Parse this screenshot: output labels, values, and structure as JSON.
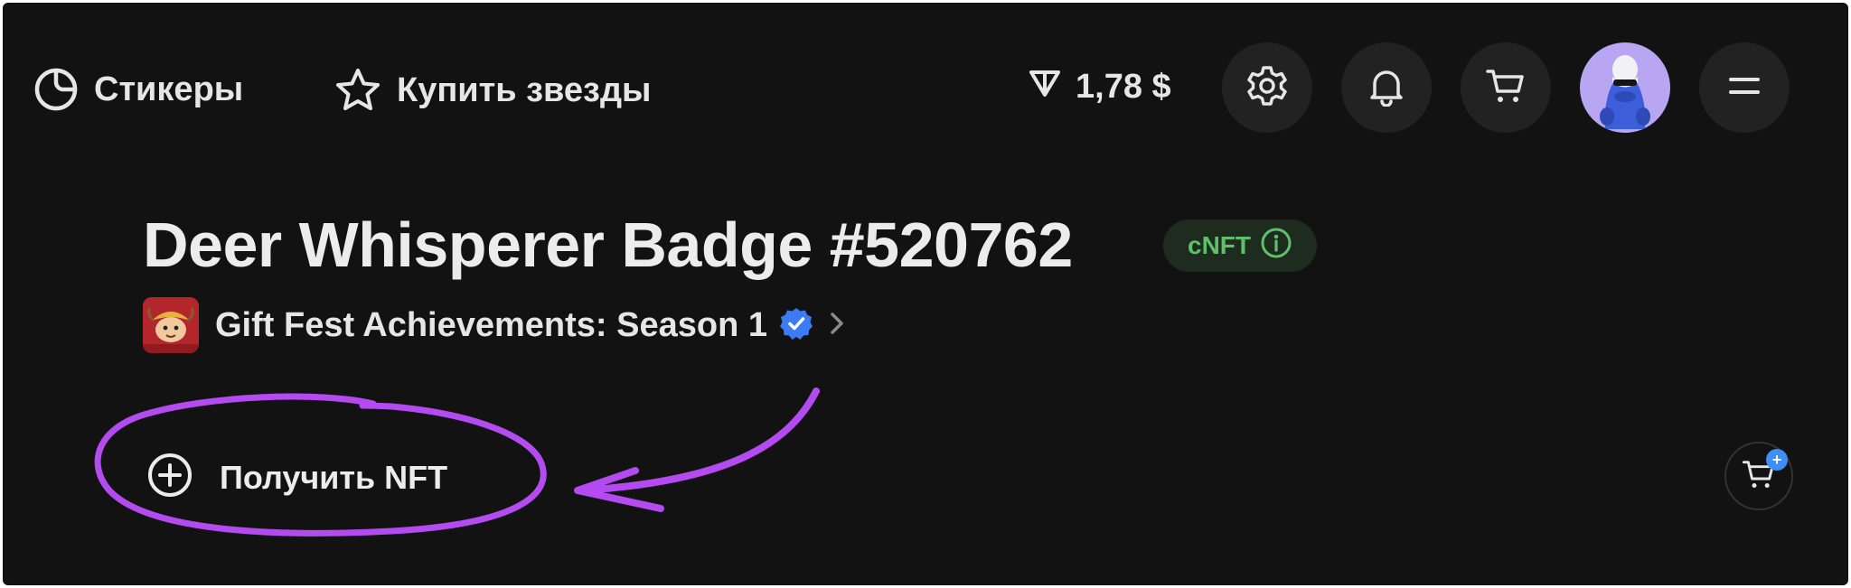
{
  "nav": {
    "stickers_label": "Стикеры",
    "buy_stars_label": "Купить звезды",
    "balance": "1,78 $",
    "icons": {
      "stickers": "sticker-icon",
      "buy_stars": "star-icon",
      "currency": "ton-icon",
      "settings": "gear-icon",
      "notifications": "bell-icon",
      "cart": "cart-icon",
      "menu": "hamburger-icon"
    }
  },
  "nft": {
    "title": "Deer Whisperer Badge #520762",
    "type_badge": "cNFT",
    "collection": "Gift Fest Achievements: Season 1",
    "collection_verified": true
  },
  "actions": {
    "get_nft_label": "Получить NFT",
    "cart_badge": "+"
  },
  "colors": {
    "background": "#121212",
    "badge_green": "#5fbf6a",
    "annotation_purple": "#b44bf0",
    "verified_blue": "#3d7bf5",
    "avatar_bg": "#b9a6f2"
  }
}
